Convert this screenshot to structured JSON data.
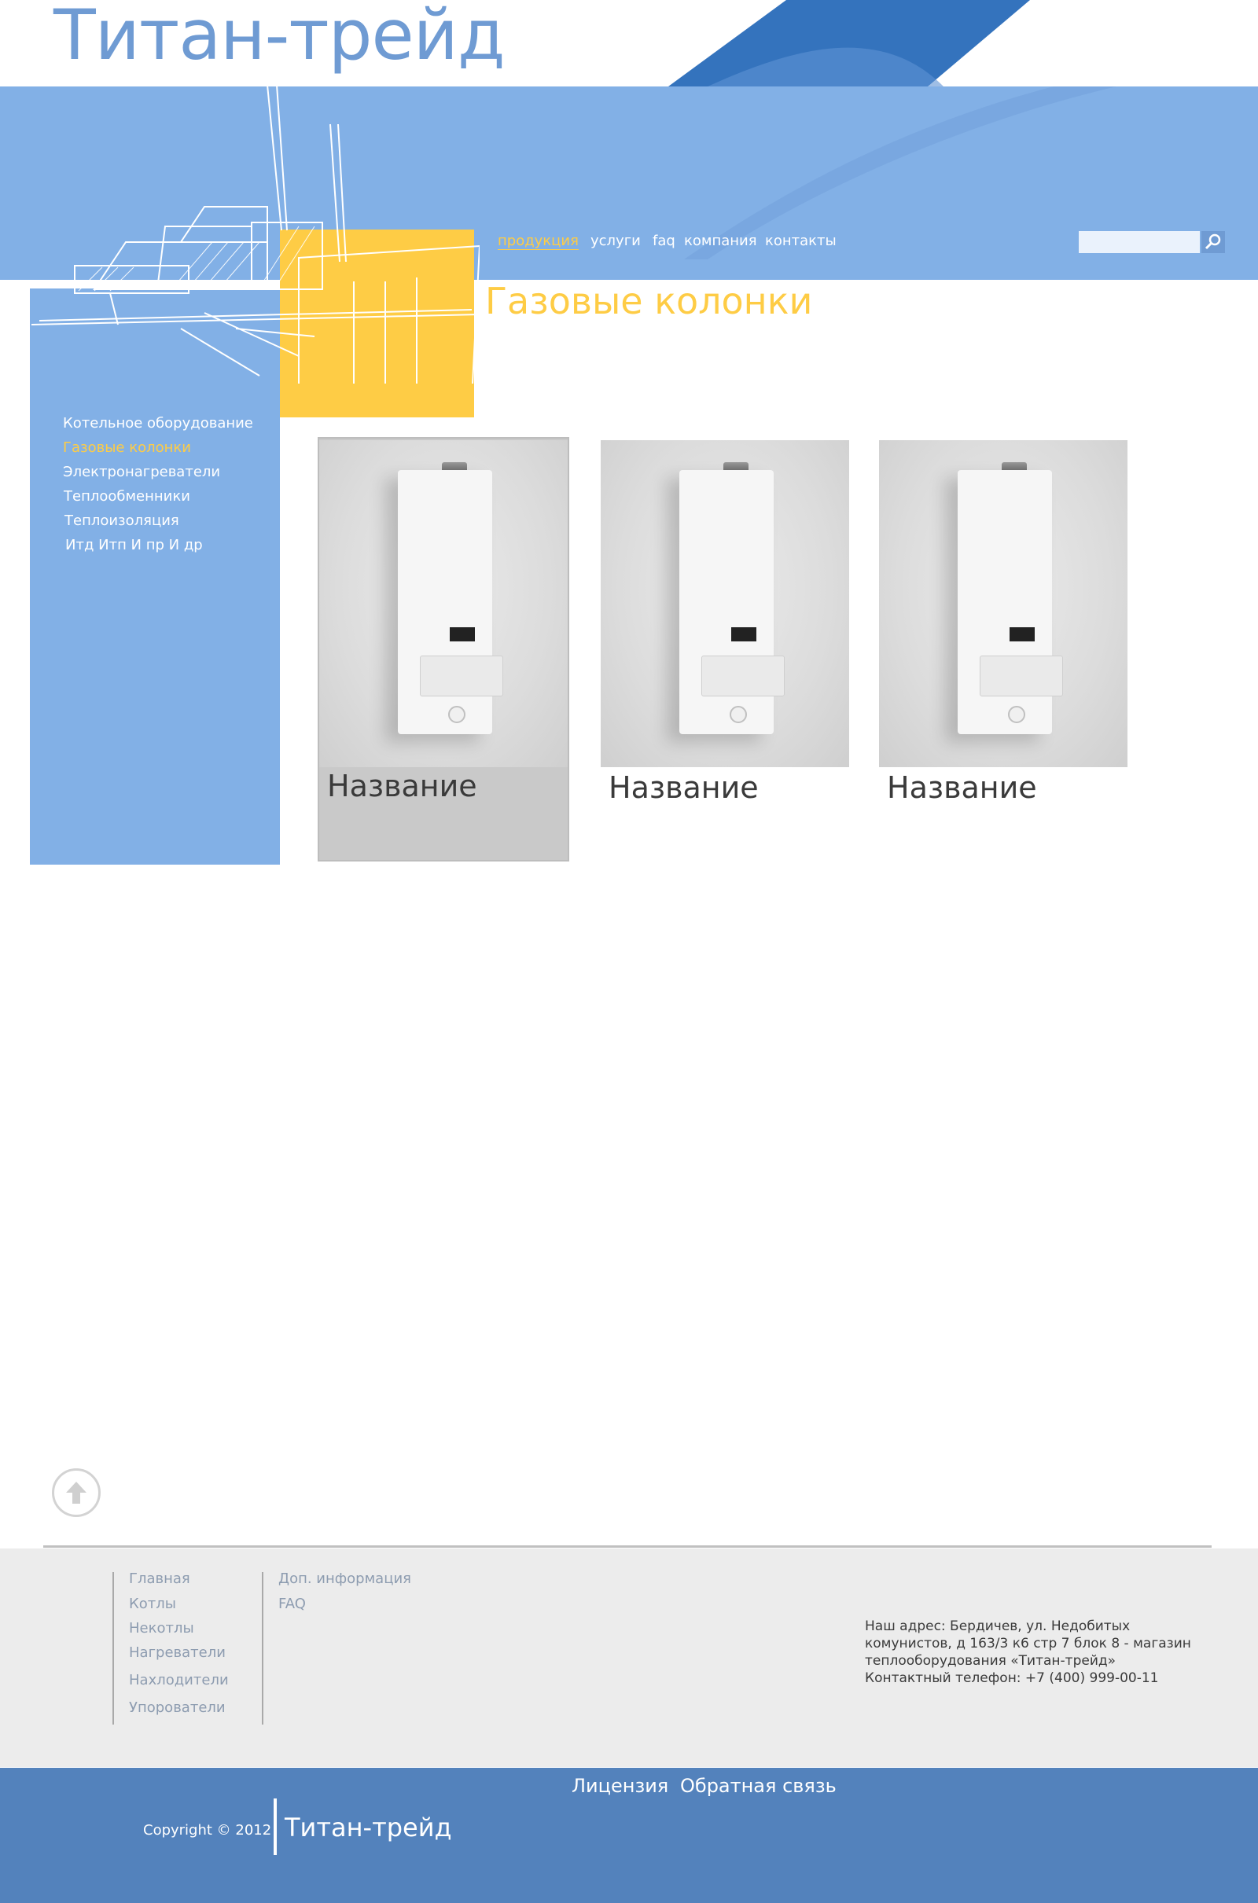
{
  "brand": {
    "logo_text": "Титан-трейд",
    "colors": {
      "blue_light": "#82b0e6",
      "blue_dark": "#3473bd",
      "yellow": "#fecc45",
      "footer_blue": "#5382bc"
    }
  },
  "nav": {
    "items": [
      {
        "label": "продукция",
        "active": true
      },
      {
        "label": "услуги"
      },
      {
        "label": "faq"
      },
      {
        "label": "компания"
      },
      {
        "label": "контакты"
      }
    ],
    "search": {
      "value": "",
      "placeholder": "",
      "icon": "search-icon"
    }
  },
  "page": {
    "title": "Газовые колонки"
  },
  "sidebar": {
    "items": [
      {
        "label": "Котельное оборудование"
      },
      {
        "label": "Газовые колонки",
        "active": true
      },
      {
        "label": "Электронагреватели"
      },
      {
        "label": "Теплообменники"
      },
      {
        "label": "Теплоизоляция"
      },
      {
        "label": "Итд Итп И пр И др"
      }
    ]
  },
  "products": [
    {
      "name": "Название",
      "highlighted": true
    },
    {
      "name": "Название"
    },
    {
      "name": "Название"
    }
  ],
  "scroll_top": {
    "icon": "arrow-up-icon"
  },
  "footer": {
    "col1": [
      "Главная",
      "Котлы",
      "Некотлы",
      "Нагреватели",
      "Нахлодители",
      "Упорователи"
    ],
    "col2": [
      "Доп. информация",
      "FAQ"
    ],
    "address": [
      "Наш адрес: Бердичев, ул. Недобитых",
      "комунистов, д 163/3 к6 стр 7 блок 8 - магазин",
      "теплооборудования «Титан-трейд»",
      "Контактный телефон: +7 (400) 999-00-11"
    ]
  },
  "bottom": {
    "links": [
      "Лицензия",
      "Обратная связь"
    ],
    "copyright": "Copyright © 2012",
    "logo": "Титан-трейд"
  }
}
